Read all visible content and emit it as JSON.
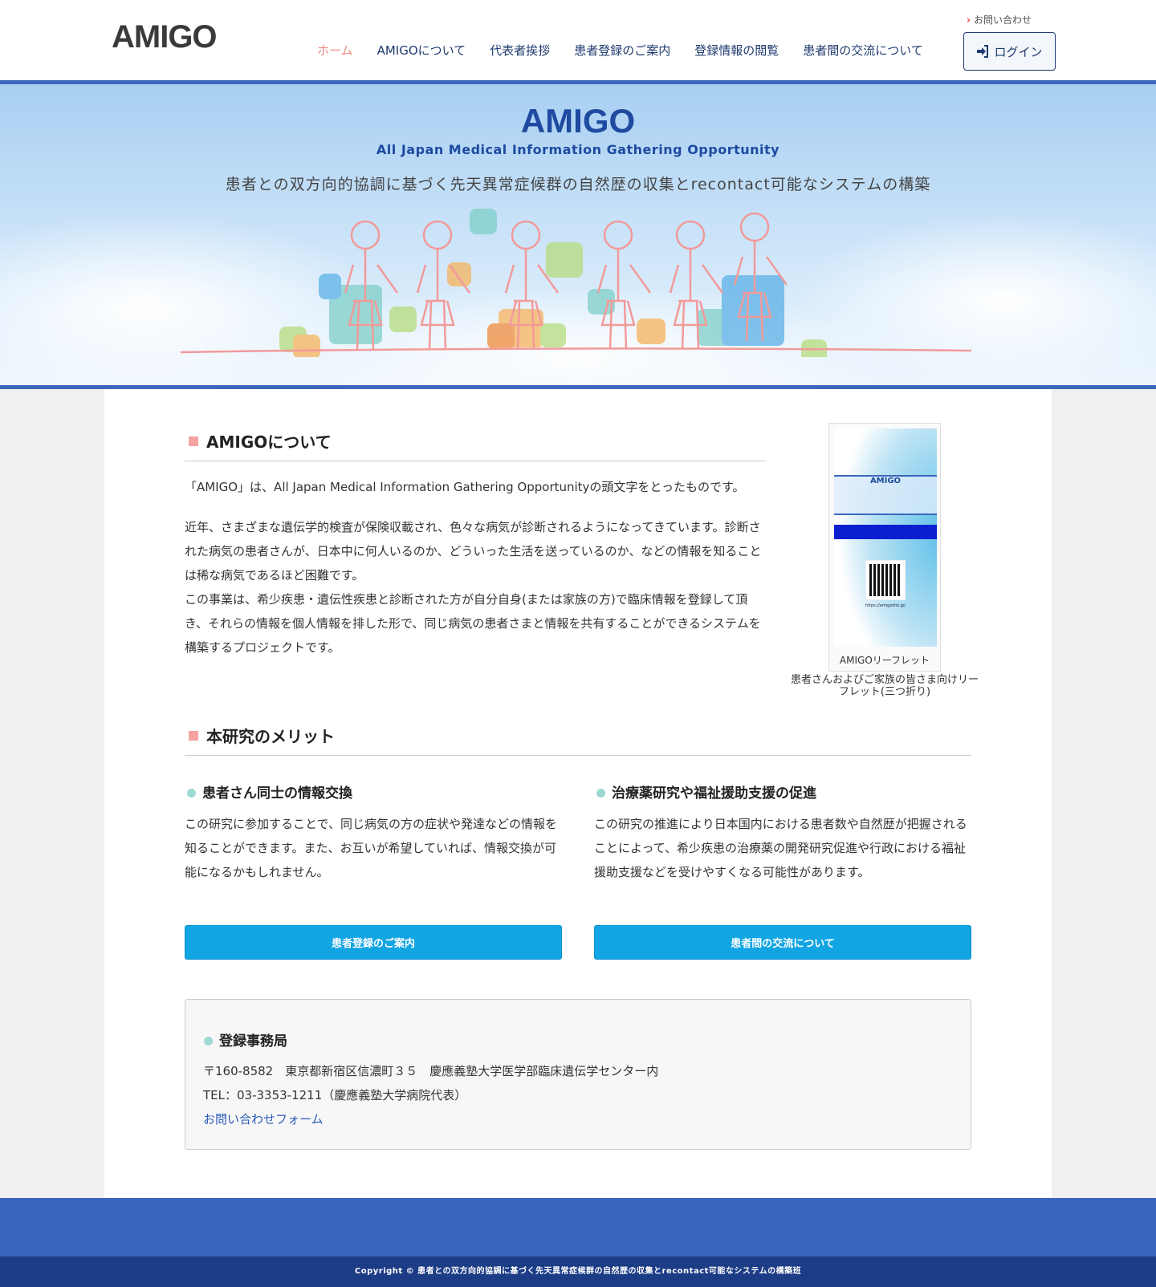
{
  "header": {
    "logo": "AMIGO",
    "contact": "お問い合わせ",
    "login": "ログイン",
    "nav": [
      "ホーム",
      "AMIGOについて",
      "代表者挨拶",
      "患者登録のご案内",
      "登録情報の閲覧",
      "患者間の交流について"
    ]
  },
  "hero": {
    "title": "AMIGO",
    "subtitle": "All Japan Medical Information Gathering Opportunity",
    "tagline": "患者との双方向的協調に基づく先天異常症候群の自然歴の収集とrecontact可能なシステムの構築"
  },
  "about": {
    "heading": "AMIGOについて",
    "intro": "「AMIGO」は、All Japan Medical Information Gathering Opportunityの頭文字をとったものです。",
    "body": "近年、さまざまな遺伝学的検査が保険収載され、色々な病気が診断されるようになってきています。診断された病気の患者さんが、日本中に何人いるのか、どういった生活を送っているのか、などの情報を知ることは稀な病気であるほど困難です。",
    "body2": "この事業は、希少疾患・遺伝性疾患と診断された方が自分自身(または家族の方)で臨床情報を登録して頂き、それらの情報を個人情報を排した形で、同じ病気の患者さまと情報を共有することができるシステムを構築するプロジェクトです。"
  },
  "leaflet": {
    "caption": "AMIGOリーフレット",
    "description": "患者さんおよびご家族の皆さま向けリーフレット(三つ折り)",
    "img_title": "AMIGO",
    "img_url": "https://amigolink.jp/"
  },
  "merits": {
    "heading": "本研究のメリット",
    "items": [
      {
        "title": "患者さん同士の情報交換",
        "text": "この研究に参加することで、同じ病気の方の症状や発達などの情報を知ることができます。また、お互いが希望していれば、情報交換が可能になるかもしれません。",
        "button": "患者登録のご案内"
      },
      {
        "title": "治療薬研究や福祉援助支援の促進",
        "text": "この研究の推進により日本国内における患者数や自然歴が把握されることによって、希少疾患の治療薬の開発研究促進や行政における福祉援助支援などを受けやすくなる可能性があります。",
        "button": "患者間の交流について"
      }
    ]
  },
  "office": {
    "heading": "登録事務局",
    "address": "〒160-8582　東京都新宿区信濃町３５　慶應義塾大学医学部臨床遺伝学センター内",
    "tel": "TEL：03-3353-1211（慶應義塾大学病院代表）",
    "form_link": "お問い合わせフォーム"
  },
  "footer": {
    "copyright": "Copyright © 患者との双方向的協調に基づく先天異常症候群の自然歴の収集とrecontact可能なシステムの構築班"
  }
}
